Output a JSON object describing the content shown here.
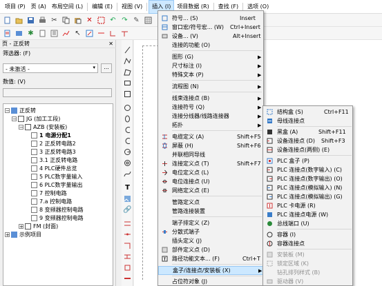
{
  "menubar": {
    "items": [
      "项目 (P)",
      "页 (A)",
      "布局空间 (L)",
      "编辑 (E)",
      "视图 (V)",
      "插入 (I)",
      "项目数据 (R)",
      "查找 (F)",
      "选项 (O)"
    ]
  },
  "left_panel": {
    "title": "页 - 正反转",
    "filter_label": "筛选器: (F)",
    "filter_value": "- 未激活 -",
    "ellipsis": "...",
    "value_label": "数值: (V)",
    "tree": {
      "root": "正反转",
      "n1": "JG (加工工段)",
      "n2": "AZB (安装板)",
      "items": [
        "1 电源分配1",
        "2 正反转电路2",
        "3 正反转电路3",
        "3.1 正反转电路",
        "4 PLC硬件总览",
        "5 PLC数字量输入",
        "6 PLC数字量输出",
        "7 控制电路",
        "7.a 控制电路",
        "8 变频器控制电路",
        "9 变频器控制电路"
      ],
      "fm": "FM (封面)",
      "example": "示例项目"
    }
  },
  "insert_menu": {
    "items": [
      {
        "label": "符号... (S)",
        "shortcut": "Insert"
      },
      {
        "label": "窗口宏/符号宏... (W)",
        "shortcut": "Ctrl+Insert"
      },
      {
        "label": "设备... (V)",
        "shortcut": "Alt+Insert"
      },
      {
        "label": "连接的功能 (O)",
        "shortcut": ""
      },
      {
        "label": "图形 (G)",
        "shortcut": ""
      },
      {
        "label": "尺寸标注 (I)",
        "shortcut": ""
      },
      {
        "label": "特殊文本 (P)",
        "shortcut": ""
      },
      {
        "label": "流程图 (N)",
        "shortcut": ""
      },
      {
        "label": "线束连接点 (B)",
        "shortcut": ""
      },
      {
        "label": "连接符号 (Q)",
        "shortcut": ""
      },
      {
        "label": "连接分线器/线路连接器",
        "shortcut": ""
      },
      {
        "label": "拓扑",
        "shortcut": ""
      },
      {
        "label": "电缆定义 (A)",
        "shortcut": "Shift+F5"
      },
      {
        "label": "屏蔽 (H)",
        "shortcut": "Shift+F6"
      },
      {
        "label": "并联相同导线",
        "shortcut": ""
      },
      {
        "label": "连接定义点 (T)",
        "shortcut": "Shift+F7"
      },
      {
        "label": "电位定义点 (L)",
        "shortcut": ""
      },
      {
        "label": "电位连接点 (U)",
        "shortcut": ""
      },
      {
        "label": "网络定义点 (E)",
        "shortcut": ""
      },
      {
        "label": "管路定义点",
        "shortcut": ""
      },
      {
        "label": "管路连接装置",
        "shortcut": ""
      },
      {
        "label": "端子排定义 (Z)",
        "shortcut": ""
      },
      {
        "label": "分散式端子",
        "shortcut": ""
      },
      {
        "label": "插头定义 (J)",
        "shortcut": ""
      },
      {
        "label": "部件定义点 (D)",
        "shortcut": ""
      },
      {
        "label": "路径功能文本... (F)",
        "shortcut": "Ctrl+T"
      },
      {
        "label": "盒子/连接点/安装板 (X)",
        "shortcut": ""
      },
      {
        "label": "占位符对象 (J)",
        "shortcut": ""
      }
    ]
  },
  "submenu": {
    "items": [
      {
        "label": "结构盒 (S)",
        "shortcut": "Ctrl+F11"
      },
      {
        "label": "母线连接点",
        "shortcut": ""
      },
      {
        "label": "黑盒 (A)",
        "shortcut": "Shift+F11"
      },
      {
        "label": "设备连接点 (D)",
        "shortcut": "Shift+F3"
      },
      {
        "label": "设备连接点(两侧) (E)",
        "shortcut": ""
      },
      {
        "label": "PLC 盒子 (P)",
        "shortcut": ""
      },
      {
        "label": "PLC 连接点(数字输入) (C)",
        "shortcut": ""
      },
      {
        "label": "PLC 连接点(数字输出) (O)",
        "shortcut": ""
      },
      {
        "label": "PLC 连接点(模拟输入) (N)",
        "shortcut": ""
      },
      {
        "label": "PLC 连接点(模拟输出) (G)",
        "shortcut": ""
      },
      {
        "label": "PLC 卡电源 (R)",
        "shortcut": ""
      },
      {
        "label": "PLC 连接点电源 (W)",
        "shortcut": ""
      },
      {
        "label": "总线端口 (U)",
        "shortcut": ""
      },
      {
        "label": "容器 (I)",
        "shortcut": ""
      },
      {
        "label": "容器连接点",
        "shortcut": ""
      },
      {
        "label": "安装板 (M)",
        "shortcut": ""
      },
      {
        "label": "锁定区域 (K)",
        "shortcut": ""
      },
      {
        "label": "钻孔排列样式 (B)",
        "shortcut": ""
      },
      {
        "label": "驱动器 (V)",
        "shortcut": ""
      }
    ]
  }
}
